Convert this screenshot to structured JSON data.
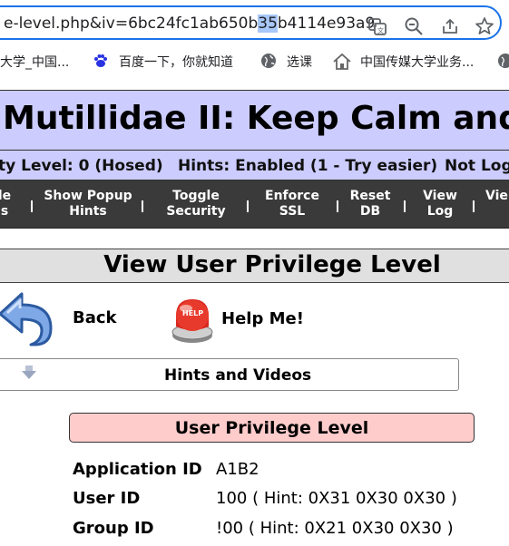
{
  "browser": {
    "url_before": "e-level.php&iv=6bc24fc1ab650b",
    "url_selected": "35",
    "url_after": "b4114e93a9",
    "bookmarks": [
      {
        "label": "大学_中国..."
      },
      {
        "label": "百度一下，你就知道"
      },
      {
        "label": "选课"
      },
      {
        "label": "中国传媒大学业务..."
      }
    ]
  },
  "header": {
    "title": "Mutillidae II: Keep Calm and Pwn",
    "security_level": "ty Level: 0 (Hosed)",
    "hints": "Hints: Enabled (1 - Try easier)",
    "login_status": "Not Log"
  },
  "nav": {
    "items": [
      {
        "line1": "le",
        "line2": "s"
      },
      {
        "line1": "Show Popup",
        "line2": "Hints"
      },
      {
        "line1": "Toggle",
        "line2": "Security"
      },
      {
        "line1": "Enforce",
        "line2": "SSL"
      },
      {
        "line1": "Reset",
        "line2": "DB"
      },
      {
        "line1": "View",
        "line2": "Log"
      },
      {
        "line1": "Vie",
        "line2": ""
      }
    ]
  },
  "page": {
    "title": "View User Privilege Level",
    "back_label": "Back",
    "help_label": "Help Me!",
    "help_badge": "HELP",
    "hints_label": "Hints and Videos",
    "box_title": "User Privilege Level",
    "rows": [
      {
        "label": "Application ID",
        "value": "A1B2"
      },
      {
        "label": "User ID",
        "value": "100 ( Hint: 0X31 0X30 0X30 )"
      },
      {
        "label": "Group ID",
        "value": "!00 ( Hint: 0X21 0X30 0X30 )"
      }
    ]
  },
  "colors": {
    "header_bg": "#ccccff",
    "nav_bg": "#3a3a3a",
    "privilege_box_bg": "#ffcccc",
    "addr_border": "#1a73e8"
  }
}
